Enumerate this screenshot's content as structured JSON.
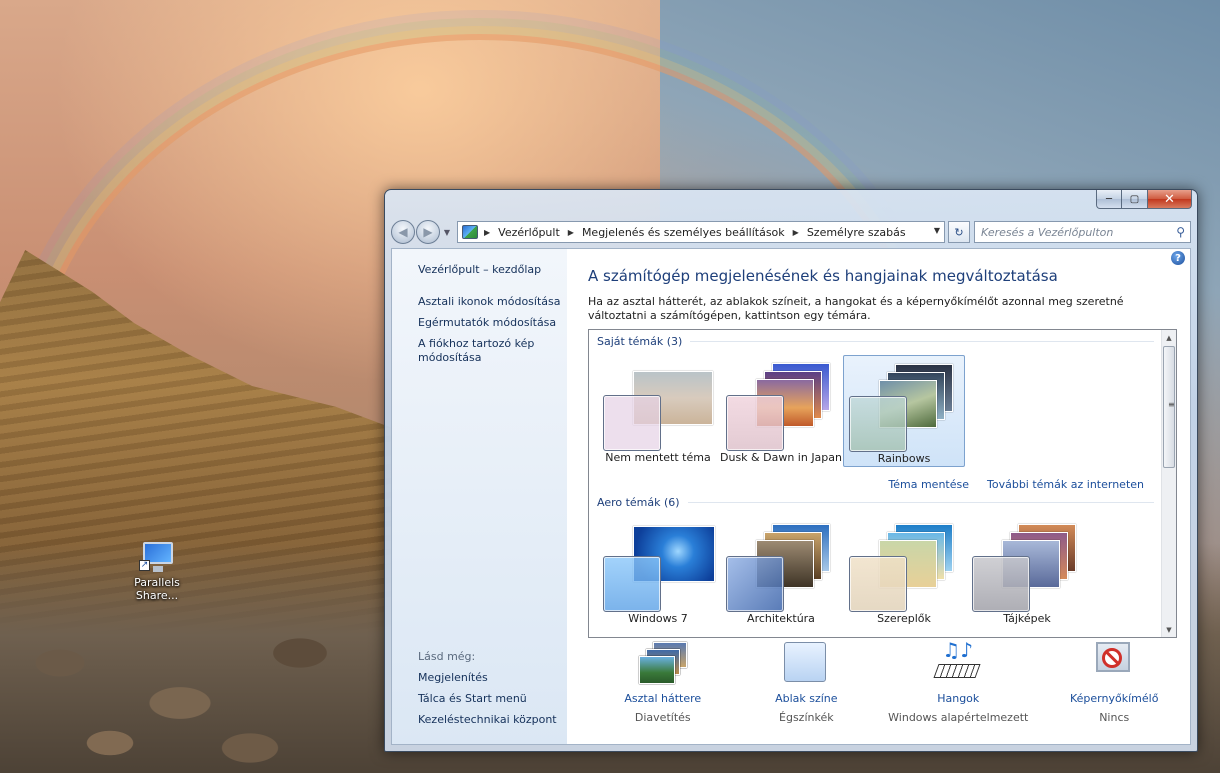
{
  "desktop": {
    "icon_label_line1": "Parallels",
    "icon_label_line2": "Share..."
  },
  "window": {
    "caption": {
      "minimize": "─",
      "maximize": "▢",
      "close": "✕"
    },
    "nav": {
      "back": "◀",
      "forward": "▶",
      "breadcrumbs": [
        "Vezérlőpult",
        "Megjelenés és személyes beállítások",
        "Személyre szabás"
      ],
      "refresh": "↻",
      "search_placeholder": "Keresés a Vezérlőpulton"
    },
    "left_pane": {
      "home": "Vezérlőpult – kezdőlap",
      "links": [
        "Asztali ikonok módosítása",
        "Egérmutatók módosítása",
        "A fiókhoz tartozó kép módosítása"
      ],
      "see_also_label": "Lásd még:",
      "see_also": [
        "Megjelenítés",
        "Tálca és Start menü",
        "Kezeléstechnikai központ"
      ]
    },
    "main": {
      "title": "A számítógép megjelenésének és hangjainak megváltoztatása",
      "description": "Ha az asztal hátterét, az ablakok színeit, a hangokat és a képernyőkímélőt azonnal meg szeretné változtatni a számítógépen, kattintson egy témára.",
      "my_themes_header": "Saját témák (3)",
      "my_themes": [
        {
          "name": "Nem mentett téma",
          "selected": false
        },
        {
          "name": "Dusk & Dawn in Japan",
          "selected": false
        },
        {
          "name": "Rainbows",
          "selected": true
        }
      ],
      "save_theme": "Téma mentése",
      "more_themes": "További témák az interneten",
      "aero_header": "Aero témák (6)",
      "aero_themes": [
        {
          "name": "Windows 7"
        },
        {
          "name": "Architektúra"
        },
        {
          "name": "Szereplők"
        },
        {
          "name": "Tájképek"
        }
      ],
      "settings": [
        {
          "link": "Asztal háttere",
          "value": "Diavetítés"
        },
        {
          "link": "Ablak színe",
          "value": "Égszínkék"
        },
        {
          "link": "Hangok",
          "value": "Windows alapértelmezett"
        },
        {
          "link": "Képernyőkímélő",
          "value": "Nincs"
        }
      ]
    }
  },
  "colors": {
    "link": "#1b4e9b",
    "title": "#1e3f7a",
    "selection": "#cfe3f8"
  }
}
